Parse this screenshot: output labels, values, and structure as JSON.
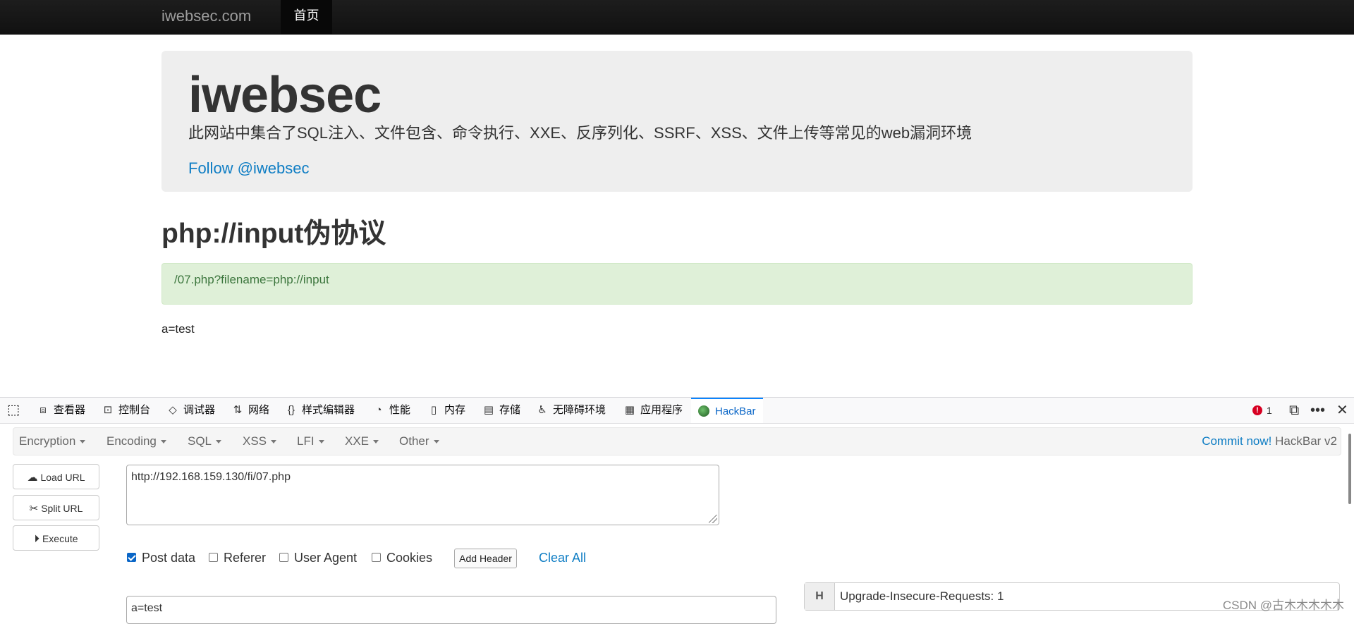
{
  "navbar": {
    "brand": "iwebsec.com",
    "active_item": "首页"
  },
  "jumbotron": {
    "title": "iwebsec",
    "subtitle": "此网站中集合了SQL注入、文件包含、命令执行、XXE、反序列化、SSRF、XSS、文件上传等常见的web漏洞环境",
    "follow_link": "Follow @iwebsec"
  },
  "page": {
    "heading": "php://input伪协议",
    "alert_text": "/07.php?filename=php://input",
    "output": "a=test"
  },
  "devtools": {
    "tabs": [
      {
        "icon": "cube-icon",
        "glyph": "⧈",
        "label": "查看器"
      },
      {
        "icon": "console-icon",
        "glyph": "⊡",
        "label": "控制台"
      },
      {
        "icon": "debugger-icon",
        "glyph": "◇",
        "label": "调试器"
      },
      {
        "icon": "network-icon",
        "glyph": "⇅",
        "label": "网络"
      },
      {
        "icon": "braces-icon",
        "glyph": "{}",
        "label": "样式编辑器"
      },
      {
        "icon": "gauge-icon",
        "glyph": "◔",
        "label": "性能"
      },
      {
        "icon": "memory-icon",
        "glyph": "▯",
        "label": "内存"
      },
      {
        "icon": "storage-icon",
        "glyph": "▤",
        "label": "存储"
      },
      {
        "icon": "accessibility-icon",
        "glyph": "♿",
        "label": "无障碍环境"
      },
      {
        "icon": "apps-grid-icon",
        "glyph": "▦",
        "label": "应用程序"
      },
      {
        "icon": "hackbar-logo-icon",
        "glyph": "",
        "label": "HackBar"
      }
    ],
    "error_count": "1",
    "error_badge": "!"
  },
  "hackbar": {
    "menus": [
      "Encryption",
      "Encoding",
      "SQL",
      "XSS",
      "LFI",
      "XXE",
      "Other"
    ],
    "commit_link": "Commit now!",
    "version": "HackBar v2",
    "buttons": {
      "load": "Load URL",
      "split": "Split URL",
      "execute": "Execute"
    },
    "url_value": "http://192.168.159.130/fi/07.php",
    "options": {
      "post_data": "Post data",
      "referer": "Referer",
      "user_agent": "User Agent",
      "cookies": "Cookies"
    },
    "add_header": "Add Header",
    "clear_all": "Clear All",
    "post_value": "a=test",
    "header_key": "H",
    "header_value": "Upgrade-Insecure-Requests: 1"
  },
  "watermark": "CSDN @古木木木木木",
  "colors": {
    "link": "#0e7dc4",
    "alert_bg": "#dff0d8",
    "active_tab": "#0a84ff"
  }
}
